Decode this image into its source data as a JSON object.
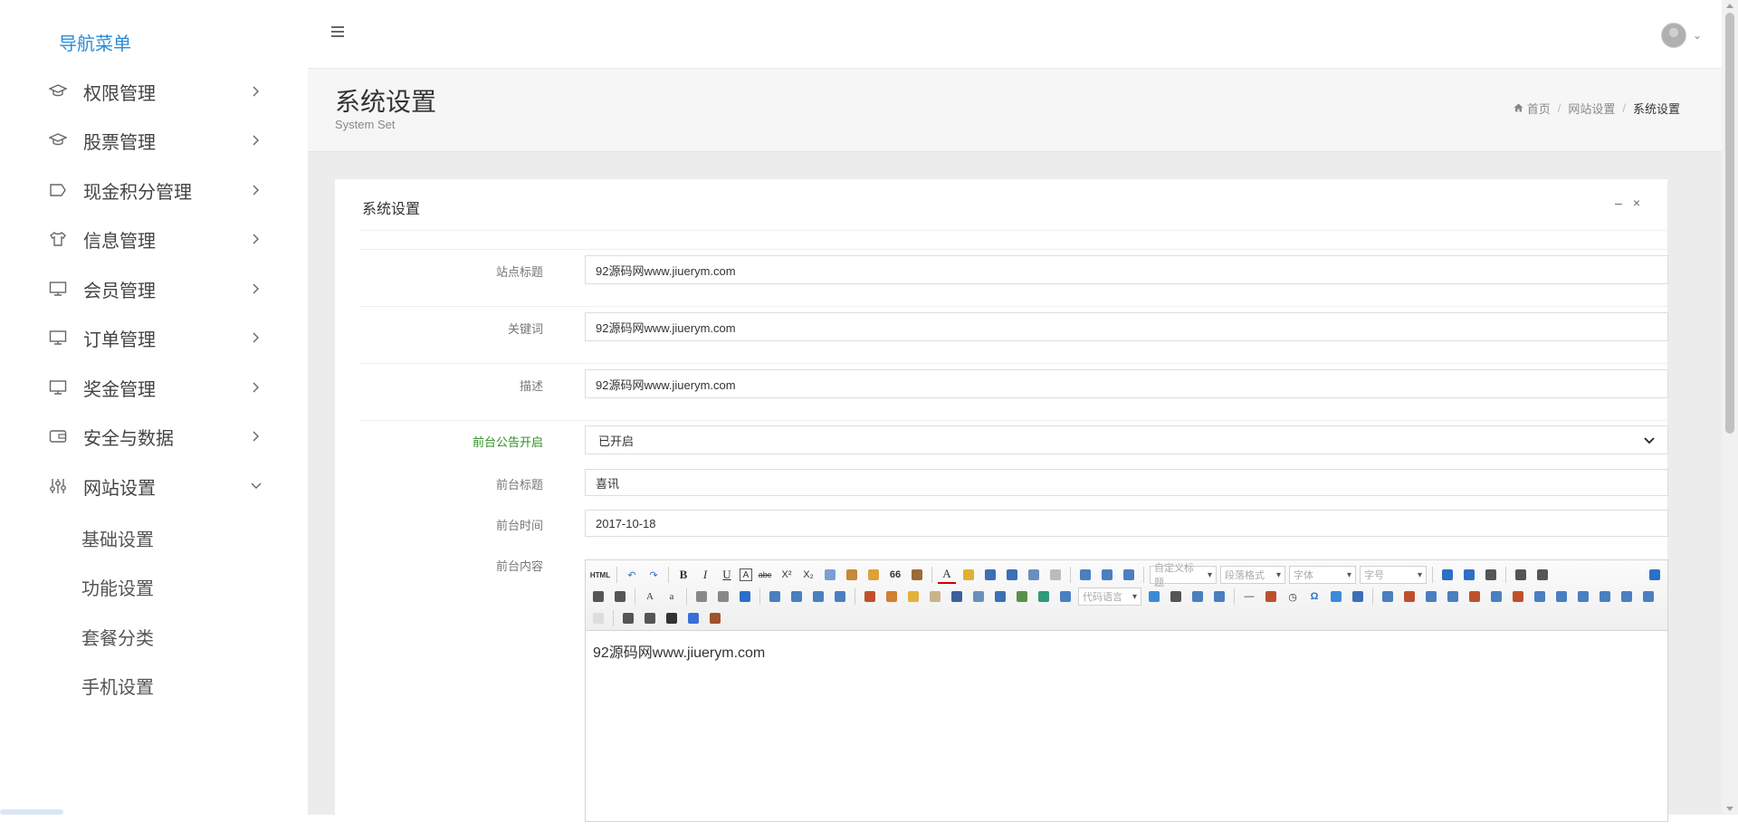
{
  "sidebar": {
    "title": "导航菜单",
    "items": [
      {
        "label": "权限管理",
        "icon": "graduation-cap-icon"
      },
      {
        "label": "股票管理",
        "icon": "graduation-cap-icon"
      },
      {
        "label": "现金积分管理",
        "icon": "tag-icon"
      },
      {
        "label": "信息管理",
        "icon": "shirt-icon"
      },
      {
        "label": "会员管理",
        "icon": "monitor-icon"
      },
      {
        "label": "订单管理",
        "icon": "monitor-icon"
      },
      {
        "label": "奖金管理",
        "icon": "monitor-icon"
      },
      {
        "label": "安全与数据",
        "icon": "wallet-icon"
      },
      {
        "label": "网站设置",
        "icon": "sliders-icon",
        "expanded": true
      }
    ],
    "subitems": [
      "基础设置",
      "功能设置",
      "套餐分类",
      "手机设置"
    ]
  },
  "topbar": {
    "menu_icon": "hamburger-icon",
    "avatar_icon": "user-avatar-icon"
  },
  "header": {
    "title": "系统设置",
    "subtitle": "System Set",
    "breadcrumb": {
      "home": "首页",
      "section": "网站设置",
      "current": "系统设置"
    }
  },
  "panel": {
    "title": "系统设置",
    "minimize": "–",
    "close": "×"
  },
  "form": {
    "site_title": {
      "label": "站点标题",
      "value": "92源码网www.jiuerym.com"
    },
    "keywords": {
      "label": "关键词",
      "value": "92源码网www.jiuerym.com"
    },
    "description": {
      "label": "描述",
      "value": "92源码网www.jiuerym.com"
    },
    "notice_enabled": {
      "label": "前台公告开启",
      "value": "已开启"
    },
    "notice_title": {
      "label": "前台标题",
      "value": "喜讯"
    },
    "notice_time": {
      "label": "前台时间",
      "value": "2017-10-18"
    },
    "notice_content": {
      "label": "前台内容",
      "value": "92源码网www.jiuerym.com"
    }
  },
  "editor": {
    "html_label": "HTML",
    "combo_custom_title": "自定义标题",
    "combo_paragraph": "段落格式",
    "combo_font": "字体",
    "combo_size": "字号",
    "combo_code": "代码语言",
    "bold": "B",
    "italic": "I",
    "underline": "U",
    "strike": "abc",
    "superscript": "X²",
    "subscript": "X₂",
    "quote": "66",
    "fontcolor": "A",
    "omega": "Ω"
  },
  "colors": {
    "accent": "#2b8cd8",
    "green": "#2c8f1f"
  }
}
